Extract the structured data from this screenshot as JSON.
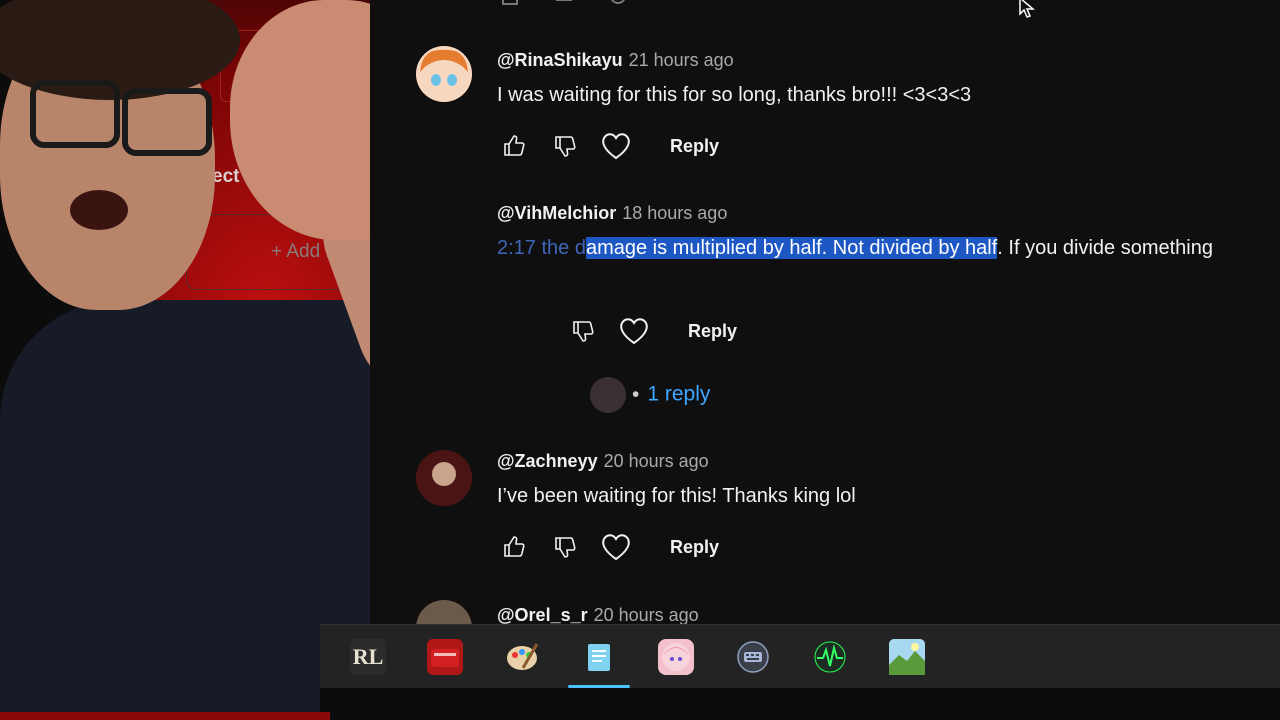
{
  "comments": [
    {
      "handle": "@RinaShikayu",
      "time": "21 hours ago",
      "text": "I was waiting for this for so long, thanks bro!!! <3<3<3",
      "reply_label": "Reply"
    },
    {
      "handle": "@VihMelchior",
      "time": "18 hours ago",
      "text_prefix": "2:17 the d",
      "text_highlight": "amage is multiplied by half. Not divided by half",
      "text_suffix": ". If you divide something",
      "reply_label": "Reply",
      "replies_link": "1 reply",
      "replies_dot": "•"
    },
    {
      "handle": "@Zachneyy",
      "time": "20 hours ago",
      "text": "I’ve been waiting for this! Thanks king lol",
      "reply_label": "Reply"
    },
    {
      "handle": "@Orel_s_r",
      "time": "20 hours ago"
    }
  ],
  "side_panel": {
    "label": "ect Layers",
    "add_button": "+ Add RG"
  },
  "taskbar": {
    "apps": [
      {
        "icon": "rl-icon",
        "text": "RL"
      },
      {
        "icon": "video-editor-icon"
      },
      {
        "icon": "paint-palette-icon"
      },
      {
        "icon": "notepad-icon"
      },
      {
        "icon": "anime-avatar-icon"
      },
      {
        "icon": "keyboard-icon"
      },
      {
        "icon": "activity-monitor-icon"
      },
      {
        "icon": "landscape-app-icon"
      }
    ]
  },
  "colors": {
    "link": "#3ea6ff",
    "highlight": "#1c57c4",
    "accent_red": "#c01010"
  }
}
